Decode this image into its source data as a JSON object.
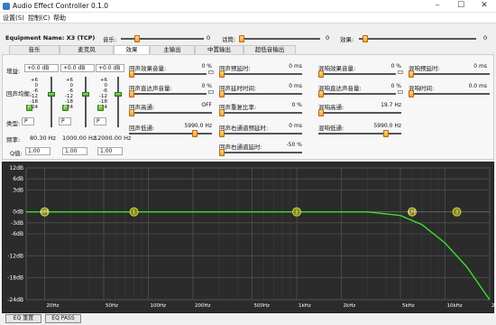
{
  "window": {
    "title": "Audio Effect Controller 0.1.0"
  },
  "menu": [
    "设置(S)",
    "控制(C)",
    "帮助"
  ],
  "toolbar": {
    "equipment": "Equipment Name: X3 (TCP)",
    "music_label": "音乐:",
    "music_value": "0",
    "far_label": "话筒:",
    "far_value": "0",
    "effect_label": "效果:",
    "effect_value": "0"
  },
  "tabs": [
    "音乐",
    "麦克风",
    "效果",
    "主输出",
    "中置输出",
    "超低音输出"
  ],
  "eq": {
    "gain_label": "增益:",
    "balance_label": "回声均衡:",
    "type_label": "类型:",
    "freq_label": "频率:",
    "q_label": "Q值:",
    "bands": [
      {
        "gain": "+0.0 dB",
        "type": "P",
        "freq": "80.30 Hz",
        "q": "1.00"
      },
      {
        "gain": "+0.0 dB",
        "type": "P",
        "freq": "1000.00 Hz",
        "q": "1.00"
      },
      {
        "gain": "+0.0 dB",
        "type": "P",
        "freq": "12000.00 Hz",
        "q": "1.00"
      }
    ],
    "scale": [
      "+6",
      "0",
      "-6",
      "-12",
      "-18",
      "-24"
    ]
  },
  "params": {
    "col1": [
      {
        "label": "回声效果音量:",
        "value": "0 %"
      },
      {
        "label": "回声直达声音量:",
        "value": "0 %"
      },
      {
        "label": "回声高通:",
        "value": "OFF"
      },
      {
        "label": "回声低通:",
        "value": "5990.0 Hz"
      }
    ],
    "col2": [
      {
        "label": "回声预延时:",
        "value": "0 ms"
      },
      {
        "label": "回声延时时间:",
        "value": "0 ms"
      },
      {
        "label": "回声重复比率:",
        "value": "0 %"
      },
      {
        "label": "回声右通道预延时:",
        "value": "0 ms"
      },
      {
        "label": "回声右通道延时:",
        "value": "-50 %"
      }
    ],
    "col3": [
      {
        "label": "混响效果音量:",
        "value": "0 %"
      },
      {
        "label": "混响直达声音量:",
        "value": "0 %"
      },
      {
        "label": "混响高通:",
        "value": "19.7 Hz"
      },
      {
        "label": "混响低通:",
        "value": "5990.0 Hz"
      }
    ],
    "col4": [
      {
        "label": "混响预延时:",
        "value": "0 ms"
      },
      {
        "label": "混响时间:",
        "value": "0.0 ms"
      }
    ]
  },
  "chart_data": {
    "type": "line",
    "xscale": "log",
    "xlim": [
      15,
      20000
    ],
    "ylim": [
      -24,
      12
    ],
    "xticks": [
      "20Hz",
      "50Hz",
      "100Hz",
      "200Hz",
      "500Hz",
      "1kHz",
      "2kHz",
      "5kHz",
      "10kHz",
      "20kHz"
    ],
    "xtick_values": [
      20,
      50,
      100,
      200,
      500,
      1000,
      2000,
      5000,
      10000,
      20000
    ],
    "yticks": [
      "12dB",
      "6dB",
      "3dB",
      "0dB",
      "-3dB",
      "-6dB",
      "-12dB",
      "-18dB",
      "-24dB"
    ],
    "ytick_values": [
      12,
      9,
      6,
      0,
      -3,
      -6,
      -12,
      -18,
      -24
    ],
    "series": [
      {
        "x": [
          15,
          20,
          100,
          1000,
          3000,
          5000,
          7000,
          10000,
          14000,
          20000
        ],
        "y": [
          0,
          0,
          0,
          0,
          0,
          -1,
          -3.5,
          -8.5,
          -15,
          -24
        ]
      }
    ],
    "markers": [
      {
        "label": "HPF",
        "x": 20,
        "y": 0
      },
      {
        "label": "1",
        "x": 80,
        "y": 0
      },
      {
        "label": "2",
        "x": 1000,
        "y": 0
      },
      {
        "label": "LPF",
        "x": 6000,
        "y": 0
      },
      {
        "label": "3",
        "x": 12000,
        "y": 0
      }
    ]
  },
  "bottom": {
    "eq_reset": "EQ 重置",
    "eq_pass": "EQ PASS"
  },
  "colors": {
    "curve": "#3adf2a",
    "graph_bg": "#2b2b2b",
    "slider_thumb": "#f3a33a"
  }
}
